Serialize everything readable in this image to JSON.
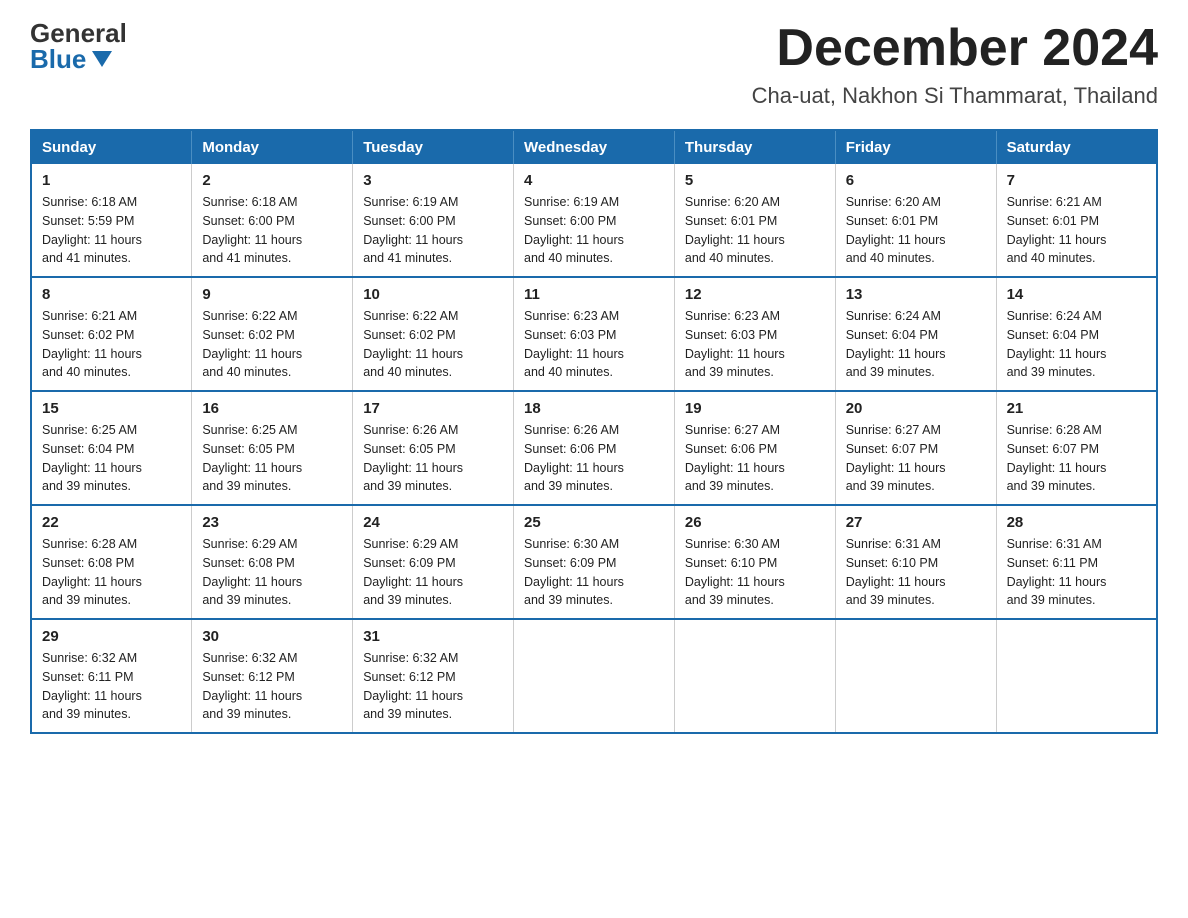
{
  "logo": {
    "general": "General",
    "blue": "Blue"
  },
  "header": {
    "title": "December 2024",
    "subtitle": "Cha-uat, Nakhon Si Thammarat, Thailand"
  },
  "weekdays": [
    "Sunday",
    "Monday",
    "Tuesday",
    "Wednesday",
    "Thursday",
    "Friday",
    "Saturday"
  ],
  "weeks": [
    [
      {
        "day": "1",
        "sunrise": "6:18 AM",
        "sunset": "5:59 PM",
        "daylight": "11 hours and 41 minutes."
      },
      {
        "day": "2",
        "sunrise": "6:18 AM",
        "sunset": "6:00 PM",
        "daylight": "11 hours and 41 minutes."
      },
      {
        "day": "3",
        "sunrise": "6:19 AM",
        "sunset": "6:00 PM",
        "daylight": "11 hours and 41 minutes."
      },
      {
        "day": "4",
        "sunrise": "6:19 AM",
        "sunset": "6:00 PM",
        "daylight": "11 hours and 40 minutes."
      },
      {
        "day": "5",
        "sunrise": "6:20 AM",
        "sunset": "6:01 PM",
        "daylight": "11 hours and 40 minutes."
      },
      {
        "day": "6",
        "sunrise": "6:20 AM",
        "sunset": "6:01 PM",
        "daylight": "11 hours and 40 minutes."
      },
      {
        "day": "7",
        "sunrise": "6:21 AM",
        "sunset": "6:01 PM",
        "daylight": "11 hours and 40 minutes."
      }
    ],
    [
      {
        "day": "8",
        "sunrise": "6:21 AM",
        "sunset": "6:02 PM",
        "daylight": "11 hours and 40 minutes."
      },
      {
        "day": "9",
        "sunrise": "6:22 AM",
        "sunset": "6:02 PM",
        "daylight": "11 hours and 40 minutes."
      },
      {
        "day": "10",
        "sunrise": "6:22 AM",
        "sunset": "6:02 PM",
        "daylight": "11 hours and 40 minutes."
      },
      {
        "day": "11",
        "sunrise": "6:23 AM",
        "sunset": "6:03 PM",
        "daylight": "11 hours and 40 minutes."
      },
      {
        "day": "12",
        "sunrise": "6:23 AM",
        "sunset": "6:03 PM",
        "daylight": "11 hours and 39 minutes."
      },
      {
        "day": "13",
        "sunrise": "6:24 AM",
        "sunset": "6:04 PM",
        "daylight": "11 hours and 39 minutes."
      },
      {
        "day": "14",
        "sunrise": "6:24 AM",
        "sunset": "6:04 PM",
        "daylight": "11 hours and 39 minutes."
      }
    ],
    [
      {
        "day": "15",
        "sunrise": "6:25 AM",
        "sunset": "6:04 PM",
        "daylight": "11 hours and 39 minutes."
      },
      {
        "day": "16",
        "sunrise": "6:25 AM",
        "sunset": "6:05 PM",
        "daylight": "11 hours and 39 minutes."
      },
      {
        "day": "17",
        "sunrise": "6:26 AM",
        "sunset": "6:05 PM",
        "daylight": "11 hours and 39 minutes."
      },
      {
        "day": "18",
        "sunrise": "6:26 AM",
        "sunset": "6:06 PM",
        "daylight": "11 hours and 39 minutes."
      },
      {
        "day": "19",
        "sunrise": "6:27 AM",
        "sunset": "6:06 PM",
        "daylight": "11 hours and 39 minutes."
      },
      {
        "day": "20",
        "sunrise": "6:27 AM",
        "sunset": "6:07 PM",
        "daylight": "11 hours and 39 minutes."
      },
      {
        "day": "21",
        "sunrise": "6:28 AM",
        "sunset": "6:07 PM",
        "daylight": "11 hours and 39 minutes."
      }
    ],
    [
      {
        "day": "22",
        "sunrise": "6:28 AM",
        "sunset": "6:08 PM",
        "daylight": "11 hours and 39 minutes."
      },
      {
        "day": "23",
        "sunrise": "6:29 AM",
        "sunset": "6:08 PM",
        "daylight": "11 hours and 39 minutes."
      },
      {
        "day": "24",
        "sunrise": "6:29 AM",
        "sunset": "6:09 PM",
        "daylight": "11 hours and 39 minutes."
      },
      {
        "day": "25",
        "sunrise": "6:30 AM",
        "sunset": "6:09 PM",
        "daylight": "11 hours and 39 minutes."
      },
      {
        "day": "26",
        "sunrise": "6:30 AM",
        "sunset": "6:10 PM",
        "daylight": "11 hours and 39 minutes."
      },
      {
        "day": "27",
        "sunrise": "6:31 AM",
        "sunset": "6:10 PM",
        "daylight": "11 hours and 39 minutes."
      },
      {
        "day": "28",
        "sunrise": "6:31 AM",
        "sunset": "6:11 PM",
        "daylight": "11 hours and 39 minutes."
      }
    ],
    [
      {
        "day": "29",
        "sunrise": "6:32 AM",
        "sunset": "6:11 PM",
        "daylight": "11 hours and 39 minutes."
      },
      {
        "day": "30",
        "sunrise": "6:32 AM",
        "sunset": "6:12 PM",
        "daylight": "11 hours and 39 minutes."
      },
      {
        "day": "31",
        "sunrise": "6:32 AM",
        "sunset": "6:12 PM",
        "daylight": "11 hours and 39 minutes."
      },
      null,
      null,
      null,
      null
    ]
  ],
  "labels": {
    "sunrise": "Sunrise:",
    "sunset": "Sunset:",
    "daylight": "Daylight:"
  }
}
